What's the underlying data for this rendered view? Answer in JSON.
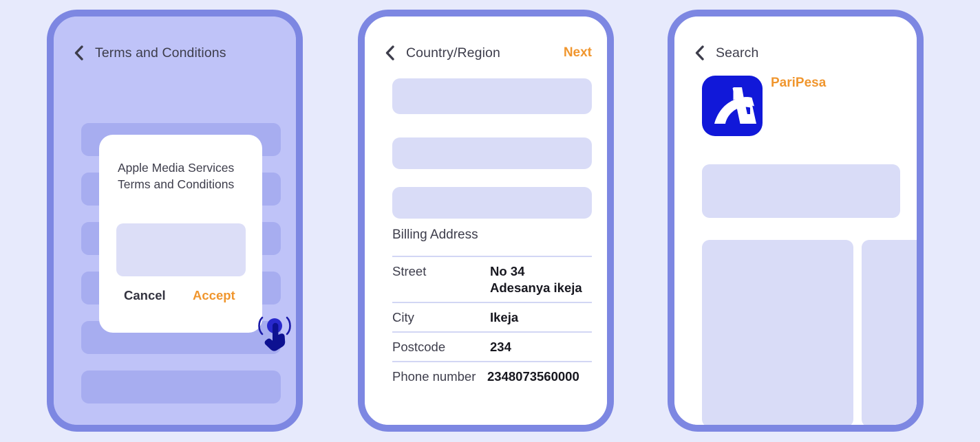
{
  "theme": {
    "page_bg": "#e7eafc",
    "frame_border": "#7d87e2",
    "panel1_bg": "#bfc3f8",
    "skeleton_dark": "#a7adf0",
    "skeleton_light": "#d9dcf7",
    "text_primary": "#3d3d4b",
    "text_strong": "#17171f",
    "accent_orange": "#f0962e",
    "cursor_blue": "#1a1aa8",
    "app_icon_blue": "#1118d9"
  },
  "panels": [
    {
      "id": "terms-and-conditions",
      "nav": {
        "back_icon": "chevron-left-icon",
        "title": "Terms and Conditions",
        "action": null
      },
      "skeleton_rows": 6,
      "dialog": {
        "title": "Apple Media Services\nTerms and Conditions",
        "body_placeholder": "content-placeholder",
        "cancel_label": "Cancel",
        "accept_label": "Accept"
      },
      "cursor": {
        "icon": "tap-cursor-icon",
        "target": "accept-button"
      }
    },
    {
      "id": "country-region",
      "nav": {
        "back_icon": "chevron-left-icon",
        "title": "Country/Region",
        "action": "Next"
      },
      "placeholders": 3,
      "section_label": "Billing Address",
      "table": {
        "rows": [
          {
            "key": "Street",
            "value": "No 34\nAdesanya ikeja"
          },
          {
            "key": "City",
            "value": "Ikeja"
          },
          {
            "key": "Postcode",
            "value": "234"
          },
          {
            "key": "Phone number",
            "value": "2348073560000"
          }
        ]
      },
      "cursor": {
        "icon": "tap-cursor-icon",
        "target": "next-button"
      }
    },
    {
      "id": "search",
      "nav": {
        "back_icon": "chevron-left-icon",
        "title": "Search",
        "action": null
      },
      "app": {
        "icon": "paripesa-app-icon",
        "name": "PariPesa"
      },
      "placeholders": 3
    }
  ]
}
